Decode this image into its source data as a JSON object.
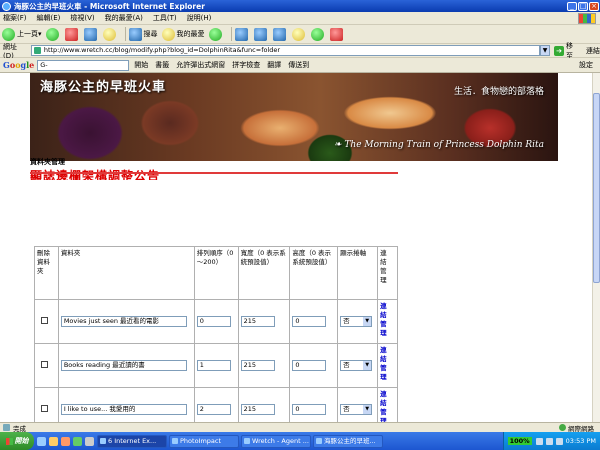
{
  "window": {
    "title": "海豚公主的早班火車 - Microsoft Internet Explorer"
  },
  "menu": [
    "檔案(F)",
    "編輯(E)",
    "檢視(V)",
    "我的最愛(A)",
    "工具(T)",
    "說明(H)"
  ],
  "toolbar": {
    "back_label": "上一頁",
    "search_label": "搜尋",
    "favorites_label": "我的最愛"
  },
  "address": {
    "label": "網址(D)",
    "url": "http://www.wretch.cc/blog/modify.php?blog_id=DolphinRita&func=folder",
    "go_label": "移至",
    "links_label": "連結"
  },
  "google_bar": {
    "logo": [
      "G",
      "o",
      "o",
      "g",
      "l",
      "e"
    ],
    "search_value": "G-",
    "items": [
      "開始",
      "書籤",
      "允許彈出式網窗",
      "拼字檢查",
      "翻譯",
      "傳送到",
      "設定"
    ]
  },
  "banner": {
    "title": "海豚公主的早班火車",
    "subtitle": "生活．食物戀的部落格",
    "english": "The Morning Train of Princess Dolphin Rita"
  },
  "page": {
    "section_label": "資料夾管理",
    "heading": "顯誌邊欄架構調整公告"
  },
  "table": {
    "headers": {
      "delete": "刪除資料夾",
      "folder": "資料夾",
      "order": "排列順序（0～200）",
      "width": "寬度（0 表示系統預設值）",
      "height": "高度（0 表示系統預設值）",
      "show_scroll": "顯示捲軸",
      "link_manage": "連結管理"
    },
    "rows": [
      {
        "folder": "Movies just seen 最近看的電影",
        "order": "0",
        "width": "215",
        "height": "0",
        "scroll": "否",
        "manage": "連結管理"
      },
      {
        "folder": "Books reading 最近讀的書",
        "order": "1",
        "width": "215",
        "height": "0",
        "scroll": "否",
        "manage": "連結管理"
      },
      {
        "folder": "I like to use... 我愛用的",
        "order": "2",
        "width": "215",
        "height": "0",
        "scroll": "否",
        "manage": "連結管理"
      }
    ]
  },
  "status": {
    "text": "完成",
    "zone": "網際網路"
  },
  "taskbar": {
    "start": "開始",
    "tasks": [
      "6 Internet Ex...",
      "PhotoImpact",
      "Wretch - Agent ...",
      "海豚公主的早班..."
    ],
    "battery": "100%",
    "clock": "03:53 PM"
  }
}
